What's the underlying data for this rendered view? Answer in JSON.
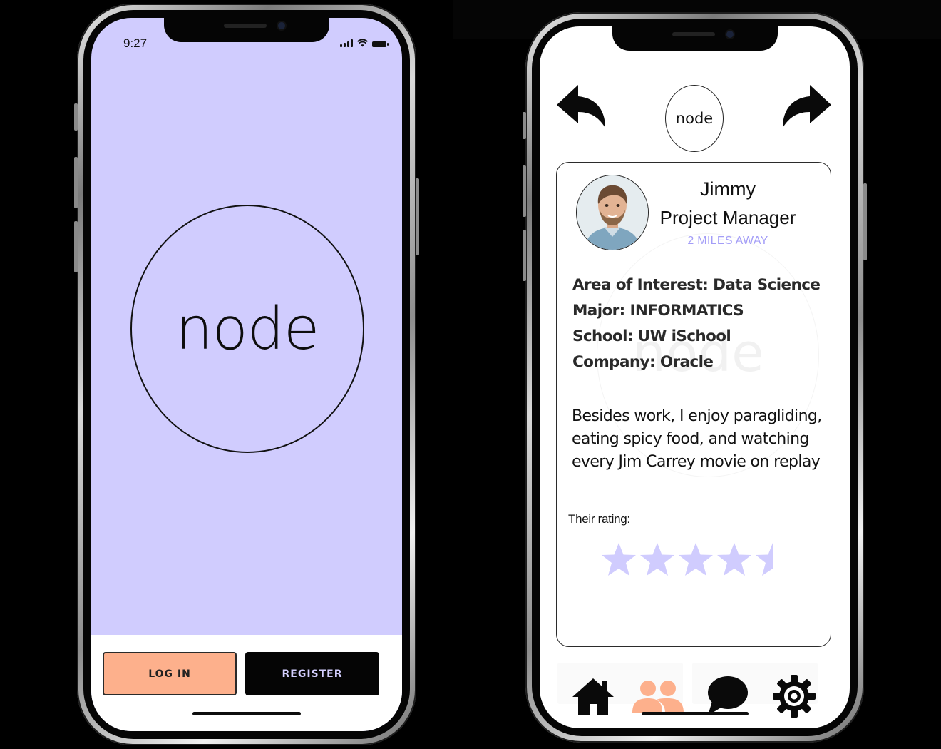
{
  "colors": {
    "lavender": "#d0ccfe",
    "peach": "#fdb08c",
    "black": "#050505",
    "distance_text": "#a39df7",
    "star": "#d0ccfe",
    "people_icon": "#fdb08c"
  },
  "welcome": {
    "status_time": "9:27",
    "logo": "node",
    "login_label": "LOG IN",
    "register_label": "REGISTER"
  },
  "profile": {
    "logo": "node",
    "name": "Jimmy",
    "role": "Project Manager",
    "distance": "2 MILES AWAY",
    "facts": [
      "Area of Interest: Data Science",
      "Major: INFORMATICS",
      "School: UW iSchool",
      "Company: Oracle"
    ],
    "bio": "Besides work, I enjoy paragliding, eating spicy food, and watching every Jim Carrey movie on replay",
    "rating_label": "Their rating:",
    "rating_value": 4.5,
    "rating_max": 5,
    "icons": {
      "back": "back-arrow-icon",
      "forward": "forward-arrow-icon",
      "home": "home-icon",
      "people": "people-icon",
      "chat": "chat-icon",
      "settings": "gear-icon"
    }
  }
}
